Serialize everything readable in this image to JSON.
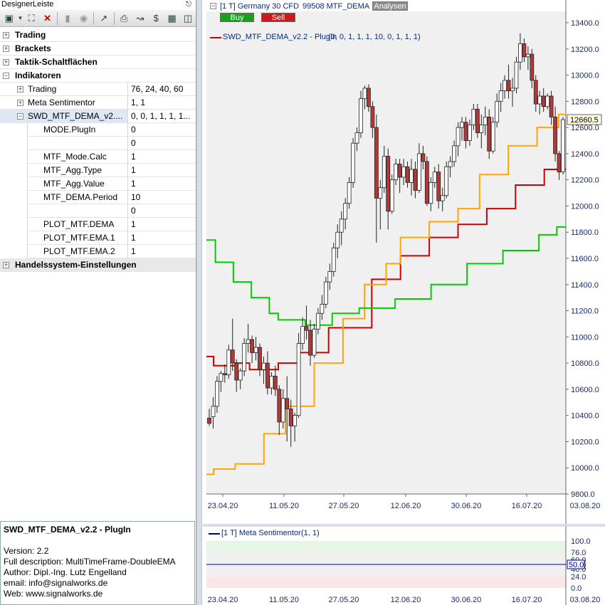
{
  "panel": {
    "title": "DesignerLeiste",
    "pin_icon": "pin-icon",
    "toolbar_icons": [
      "select-tool-icon",
      "dropdown-arrow-icon",
      "crosshair-icon",
      "delete-icon",
      "sidebar-icon",
      "properties-icon",
      "trendline-icon",
      "print-icon",
      "draw-icon",
      "dollar-swap-icon",
      "grid-icon",
      "window-icon"
    ]
  },
  "tree": {
    "categories": {
      "trading": "Trading",
      "brackets": "Brackets",
      "tactics": "Taktik-Schaltflächen",
      "indicators": "Indikatoren",
      "system": "Handelssystem-Einstellungen"
    },
    "indicators": [
      {
        "name": "Trading",
        "value": "76, 24, 40, 60"
      },
      {
        "name": "Meta Sentimentor",
        "value": "1, 1"
      },
      {
        "name": "SWD_MTF_DEMA_v2....",
        "value": "0, 0, 1, 1, 1, 1..."
      }
    ],
    "params": [
      {
        "name": "MODE.PlugIn",
        "value": "0"
      },
      {
        "name": "",
        "value": "0"
      },
      {
        "name": "MTF_Mode.Calc",
        "value": "1"
      },
      {
        "name": "MTF_Agg.Type",
        "value": "1"
      },
      {
        "name": "MTF_Agg.Value",
        "value": "1"
      },
      {
        "name": "MTF_DEMA.Period",
        "value": "10"
      },
      {
        "name": "",
        "value": "0"
      },
      {
        "name": "PLOT_MTF.DEMA",
        "value": "1"
      },
      {
        "name": "PLOT_MTF.EMA.1",
        "value": "1"
      },
      {
        "name": "PLOT_MTF.EMA.2",
        "value": "1"
      }
    ]
  },
  "description": {
    "title": "SWD_MTF_DEMA_v2.2 - PlugIn",
    "lines": [
      "Version: 2.2",
      "Full description: MultiTimeFrame-DoubleEMA",
      "Author: Dipl.-Ing. Lutz Engelland",
      "email: info@signalworks.de",
      "Web: www.signalworks.de"
    ]
  },
  "chart_header": {
    "instrument": "[1 T] Germany 30 CFD",
    "sub": "99508 MTF_DEMA",
    "analyze_button": "Analysen",
    "buy_label": "Buy",
    "sell_label": "Sell",
    "indicator_label": "SWD_MTF_DEMA_v2.2 - PlugIn",
    "indicator_params": "(0, 0, 1, 1, 1, 10, 0, 1, 1, 1)",
    "colors": {
      "buy": "#1aa01a",
      "sell": "#cc1a1a",
      "dema": "#cc0000",
      "ema1": "#ffa500",
      "ema2": "#00cc00",
      "up_candle": "#ffffff",
      "down_candle": "#b03a3a"
    }
  },
  "sub_header": {
    "label": "[1 T] Meta Sentimentor",
    "params": "(1, 1)"
  },
  "chart_data": [
    {
      "type": "candlestick",
      "title": "[1 T] Germany 30 CFD",
      "y_ticks": [
        "13400.0",
        "13200.0",
        "13000.0",
        "12800.0",
        "12600.0",
        "12400.0",
        "12200.0",
        "12000.0",
        "11800.0",
        "11600.0",
        "11400.0",
        "11200.0",
        "11000.0",
        "10800.0",
        "10600.0",
        "10400.0",
        "10200.0",
        "10000.0",
        "9800.0"
      ],
      "ylim": [
        9800,
        13400
      ],
      "x_ticks": [
        "23.04.20",
        "11.05.20",
        "27.05.20",
        "12.06.20",
        "30.06.20",
        "16.07.20",
        "03.08.20"
      ],
      "last_price": "12660.5",
      "candles": [
        [
          10380,
          10450,
          10320,
          10340
        ],
        [
          10390,
          10540,
          10300,
          10470
        ],
        [
          10470,
          10700,
          10420,
          10660
        ],
        [
          10660,
          10740,
          10580,
          10720
        ],
        [
          10720,
          10790,
          10650,
          10710
        ],
        [
          10710,
          10940,
          10680,
          10900
        ],
        [
          10900,
          11140,
          10740,
          10800
        ],
        [
          10800,
          10830,
          10580,
          10670
        ],
        [
          10670,
          10760,
          10600,
          10740
        ],
        [
          10740,
          10990,
          10700,
          10950
        ],
        [
          10950,
          11100,
          10880,
          10980
        ],
        [
          10980,
          11010,
          10800,
          10880
        ],
        [
          10880,
          11000,
          10820,
          10920
        ],
        [
          10920,
          10950,
          10700,
          10750
        ],
        [
          10750,
          10850,
          10640,
          10800
        ],
        [
          10800,
          10890,
          10560,
          10610
        ],
        [
          10610,
          10730,
          10560,
          10700
        ],
        [
          10700,
          10780,
          10550,
          10600
        ],
        [
          10600,
          10630,
          10250,
          10350
        ],
        [
          10350,
          10600,
          10300,
          10530
        ],
        [
          10530,
          10700,
          10200,
          10450
        ],
        [
          10450,
          10520,
          10160,
          10320
        ],
        [
          10320,
          10420,
          10200,
          10400
        ],
        [
          10400,
          11030,
          10380,
          10950
        ],
        [
          10950,
          11150,
          10900,
          11080
        ],
        [
          11080,
          11240,
          10980,
          11050
        ],
        [
          11050,
          11130,
          10780,
          10860
        ],
        [
          10860,
          11100,
          10840,
          11060
        ],
        [
          11060,
          11220,
          11020,
          11180
        ],
        [
          11180,
          11320,
          11130,
          11250
        ],
        [
          11250,
          11460,
          11220,
          11420
        ],
        [
          11420,
          11560,
          11360,
          11500
        ],
        [
          11500,
          11720,
          11460,
          11680
        ],
        [
          11680,
          11860,
          11600,
          11800
        ],
        [
          11800,
          11960,
          11700,
          11900
        ],
        [
          11900,
          12060,
          11820,
          12020
        ],
        [
          12020,
          12220,
          11980,
          12180
        ],
        [
          12180,
          12520,
          12140,
          12480
        ],
        [
          12480,
          12600,
          12420,
          12560
        ],
        [
          12560,
          12880,
          12520,
          12820
        ],
        [
          12820,
          12920,
          12740,
          12900
        ],
        [
          12900,
          12930,
          12720,
          12760
        ],
        [
          12760,
          12800,
          12520,
          12600
        ],
        [
          12600,
          12700,
          11720,
          12060
        ],
        [
          12060,
          12200,
          11820,
          12140
        ],
        [
          12140,
          12460,
          12100,
          12380
        ],
        [
          12380,
          12440,
          11820,
          11960
        ],
        [
          11960,
          12240,
          11940,
          12200
        ],
        [
          12200,
          12360,
          12160,
          12320
        ],
        [
          12320,
          12360,
          12100,
          12220
        ],
        [
          12220,
          12360,
          12160,
          12300
        ],
        [
          12300,
          12340,
          12140,
          12180
        ],
        [
          12180,
          12360,
          12080,
          12280
        ],
        [
          12280,
          12340,
          12060,
          12120
        ],
        [
          12120,
          12480,
          12100,
          12400
        ],
        [
          12400,
          12460,
          12280,
          12340
        ],
        [
          12340,
          12380,
          12000,
          12020
        ],
        [
          12020,
          12220,
          11960,
          12180
        ],
        [
          12180,
          12300,
          12140,
          12260
        ],
        [
          12260,
          12320,
          11980,
          12040
        ],
        [
          12040,
          12140,
          11960,
          12080
        ],
        [
          12080,
          12340,
          12060,
          12300
        ],
        [
          12300,
          12380,
          12220,
          12340
        ],
        [
          12340,
          12500,
          12300,
          12460
        ],
        [
          12460,
          12640,
          12380,
          12600
        ],
        [
          12600,
          12680,
          12500,
          12640
        ],
        [
          12640,
          12680,
          12440,
          12500
        ],
        [
          12500,
          12660,
          12460,
          12620
        ],
        [
          12620,
          12780,
          12580,
          12740
        ],
        [
          12740,
          12780,
          12520,
          12560
        ],
        [
          12560,
          12700,
          12440,
          12620
        ],
        [
          12620,
          12760,
          12540,
          12680
        ],
        [
          12680,
          12740,
          12360,
          12420
        ],
        [
          12420,
          12680,
          12400,
          12640
        ],
        [
          12640,
          12860,
          12600,
          12800
        ],
        [
          12800,
          12940,
          12720,
          12880
        ],
        [
          12880,
          13000,
          12820,
          12960
        ],
        [
          12960,
          13080,
          12820,
          12880
        ],
        [
          12880,
          12980,
          12760,
          12900
        ],
        [
          12900,
          13140,
          12860,
          13100
        ],
        [
          13100,
          13320,
          13040,
          13240
        ],
        [
          13240,
          13280,
          13100,
          13140
        ],
        [
          13140,
          13220,
          13040,
          13160
        ],
        [
          13160,
          13200,
          12900,
          12960
        ],
        [
          12960,
          13000,
          12720,
          12780
        ],
        [
          12780,
          12880,
          12700,
          12840
        ],
        [
          12840,
          12900,
          12720,
          12760
        ],
        [
          12760,
          12860,
          12740,
          12840
        ],
        [
          12840,
          12880,
          12620,
          12680
        ],
        [
          12680,
          12760,
          12340,
          12400
        ],
        [
          12400,
          12420,
          12200,
          12260
        ],
        [
          12260,
          12680,
          12240,
          12660
        ]
      ],
      "series": [
        {
          "name": "MTF_DEMA",
          "color": "#cc0000",
          "values": [
            10850,
            10780,
            10780,
            10780,
            10800,
            10800,
            10750,
            10750,
            10750,
            10750,
            10800,
            10800,
            10800,
            10880,
            10880,
            10880,
            10880,
            11070,
            11070,
            11070,
            11070,
            11070,
            11070,
            11440,
            11440,
            11440,
            11440,
            11620,
            11620,
            11620,
            11620,
            11760,
            11760,
            11760,
            11760,
            11860,
            11860,
            11860,
            11860,
            11980,
            11980,
            11980,
            11980,
            12160,
            12160,
            12160,
            12160,
            12280,
            12280,
            12280,
            12280
          ]
        },
        {
          "name": "MTF_EMA1",
          "color": "#ffa500",
          "values": [
            9950,
            9990,
            9990,
            9990,
            10030,
            10030,
            10030,
            10030,
            10260,
            10260,
            10260,
            10470,
            10470,
            10470,
            10470,
            10800,
            10800,
            10800,
            10800,
            11140,
            11140,
            11140,
            11400,
            11400,
            11400,
            11560,
            11560,
            11760,
            11760,
            11760,
            11760,
            11880,
            11880,
            11880,
            11880,
            11980,
            11980,
            11980,
            12240,
            12240,
            12240,
            12240,
            12460,
            12460,
            12460,
            12460,
            12600,
            12600,
            12600,
            12700,
            12700
          ]
        },
        {
          "name": "MTF_EMA2",
          "color": "#00cc00",
          "values": [
            11740,
            11570,
            11570,
            11420,
            11420,
            11300,
            11300,
            11180,
            11130,
            11130,
            11130,
            11090,
            11090,
            11090,
            11180,
            11180,
            11180,
            11220,
            11220,
            11220,
            11220,
            11290,
            11290,
            11290,
            11290,
            11400,
            11400,
            11400,
            11400,
            11560,
            11560,
            11560,
            11560,
            11660,
            11660,
            11660,
            11660,
            11780,
            11780,
            11840,
            11840
          ]
        }
      ]
    },
    {
      "type": "line",
      "title": "[1 T] Meta Sentimentor",
      "y_ticks": [
        "100.0",
        "76.0",
        "60.0",
        "50.0",
        "40.0",
        "24.0",
        "0.0"
      ],
      "ylim": [
        0,
        100
      ],
      "x_ticks": [
        "23.04.20",
        "11.05.20",
        "27.05.20",
        "12.06.20",
        "30.06.20",
        "16.07.20",
        "03.08.20"
      ],
      "last_value": "50.0",
      "series": [
        {
          "name": "Meta Sentimentor",
          "color": "#000080",
          "values": [
            50,
            50
          ]
        }
      ]
    }
  ]
}
